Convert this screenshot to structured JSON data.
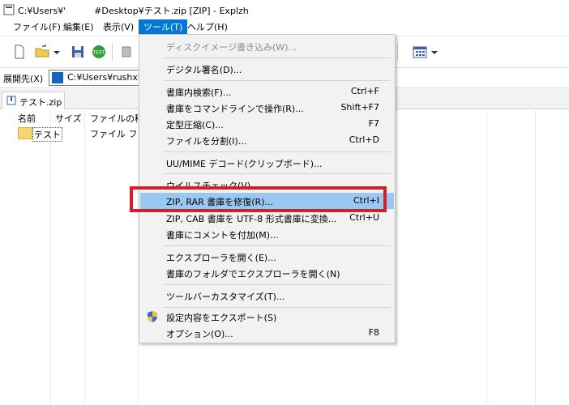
{
  "window": {
    "title": "C:¥Users¥'          #Desktop¥テスト.zip [ZIP] - Explzh"
  },
  "menubar": [
    {
      "label": "ファイル(F)"
    },
    {
      "label": "編集(E)"
    },
    {
      "label": "表示(V)"
    },
    {
      "label": "ツール(T)"
    },
    {
      "label": "ヘルプ(H)"
    }
  ],
  "extract_bar": {
    "label": "展開先(X)",
    "path": "C:¥Users¥rushx¥D"
  },
  "tabs": [
    {
      "label": "テスト.zip"
    }
  ],
  "file_list": {
    "columns": [
      "名前",
      "サイズ",
      "ファイルの種類"
    ],
    "rows": [
      {
        "name": "テスト",
        "type": "ファイル フォル"
      }
    ]
  },
  "tools_menu": [
    {
      "label": "ディスクイメージ書き込み(W)...",
      "shortcut": "",
      "disabled": true
    },
    {
      "label": "デジタル署名(D)...",
      "shortcut": ""
    },
    {
      "label": "書庫内検索(F)...",
      "shortcut": "Ctrl+F"
    },
    {
      "label": "書庫をコマンドラインで操作(R)...",
      "shortcut": "Shift+F7"
    },
    {
      "label": "定型圧縮(C)...",
      "shortcut": "F7"
    },
    {
      "label": "ファイルを分割(I)...",
      "shortcut": "Ctrl+D"
    },
    {
      "label": "UU/MIME デコード(クリップボード)...",
      "shortcut": ""
    },
    {
      "label": "ウイルスチェック(V)",
      "shortcut": ""
    },
    {
      "label": "ZIP, RAR 書庫を修復(R)...",
      "shortcut": "Ctrl+I",
      "highlighted": true
    },
    {
      "label": "ZIP, CAB 書庫を UTF-8 形式書庫に変換...",
      "shortcut": "Ctrl+U"
    },
    {
      "label": "書庫にコメントを付加(M)...",
      "shortcut": ""
    },
    {
      "label": "エクスプローラを開く(E)...",
      "shortcut": ""
    },
    {
      "label": "書庫のフォルダでエクスプローラを開く(N)",
      "shortcut": ""
    },
    {
      "label": "ツールバーカスタマイズ(T)...",
      "shortcut": ""
    },
    {
      "label": "設定内容をエクスポート(S)",
      "shortcut": ""
    },
    {
      "label": "オプション(O)...",
      "shortcut": "F8"
    }
  ],
  "colors": {
    "menu_active": "#0078d7",
    "item_highlight": "#99c9f3",
    "annotation_red": "#d21f2b"
  }
}
